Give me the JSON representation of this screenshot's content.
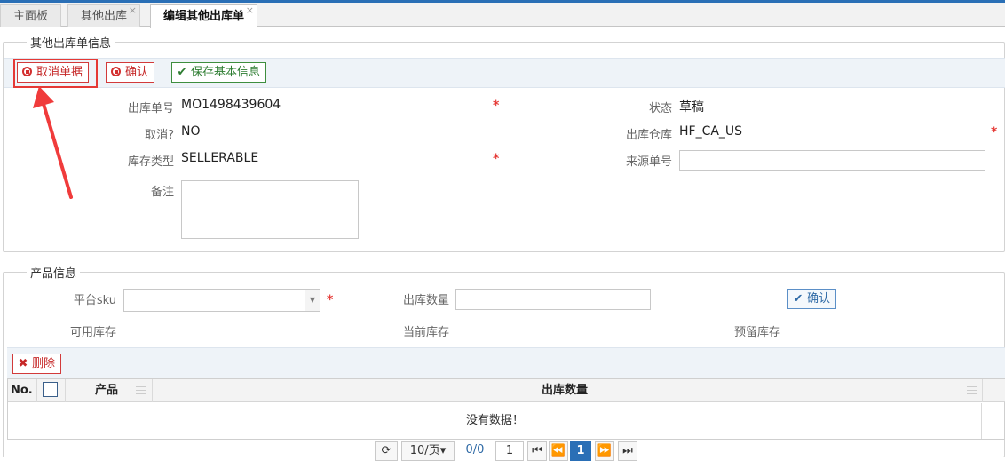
{
  "tabs": [
    {
      "label": "主面板",
      "closable": false
    },
    {
      "label": "其他出库",
      "closable": true
    },
    {
      "label": "编辑其他出库单",
      "closable": true,
      "active": true
    }
  ],
  "close_glyph": "×",
  "order_section": {
    "legend": "其他出库单信息",
    "buttons": {
      "cancel_doc": "取消单据",
      "confirm": "确认",
      "save_basic": "保存基本信息"
    },
    "fields": {
      "order_no_label": "出库单号",
      "order_no_value": "MO1498439604",
      "status_label": "状态",
      "status_value": "草稿",
      "cancelled_label": "取消?",
      "cancelled_value": "NO",
      "warehouse_label": "出库仓库",
      "warehouse_value": "HF_CA_US",
      "stock_type_label": "库存类型",
      "stock_type_value": "SELLERABLE",
      "source_no_label": "来源单号",
      "source_no_value": "",
      "remark_label": "备注",
      "remark_value": ""
    },
    "required_mark": "*"
  },
  "product_section": {
    "legend": "产品信息",
    "platform_sku_label": "平台sku",
    "platform_sku_value": "",
    "out_qty_label": "出库数量",
    "out_qty_value": "",
    "confirm_label": "确认",
    "available_stock_label": "可用库存",
    "current_stock_label": "当前库存",
    "reserved_stock_label": "预留库存",
    "delete_label": "删除"
  },
  "grid": {
    "columns": [
      "No.",
      "产品",
      "出库数量"
    ],
    "empty_text": "没有数据！"
  },
  "pager": {
    "page_size": "10/页",
    "count": "0/0",
    "page_input": "1",
    "current_page": "1"
  },
  "colors": {
    "accent": "#2a6fb6",
    "danger": "#d32f2f",
    "success": "#2e7d32",
    "annotation": "#e53935"
  },
  "icons": {
    "cancel": "stop-circle-icon",
    "confirm": "stop-circle-icon",
    "save": "check-icon",
    "delete": "x-icon",
    "refresh": "refresh-icon",
    "first": "first-page-icon",
    "prev": "prev-page-icon",
    "next": "next-page-icon",
    "last": "last-page-icon",
    "annotation": "red-arrow-icon"
  }
}
